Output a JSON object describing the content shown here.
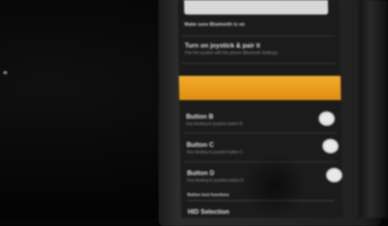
{
  "settings": {
    "intro": "Make sure Bluetooth is on",
    "pair": {
      "title": "Turn on joystick & pair it",
      "subtitle": "Pair the joystick with this phone (Bluetooth Settings)"
    },
    "buttons": [
      {
        "title": "Button B",
        "subtitle": "Key binding to joystick button B",
        "toggle": "off"
      },
      {
        "title": "Button C",
        "subtitle": "Key binding to joystick button C",
        "toggle": "off"
      },
      {
        "title": "Button D",
        "subtitle": "Key binding to joystick button D",
        "toggle": "off"
      }
    ],
    "section_header": "Button lock functions",
    "next_item": "HID Selection"
  },
  "colors": {
    "highlight": "#f0a020",
    "screen_background": "#1b1b1b",
    "toggle_off": "#e9e9e9"
  }
}
